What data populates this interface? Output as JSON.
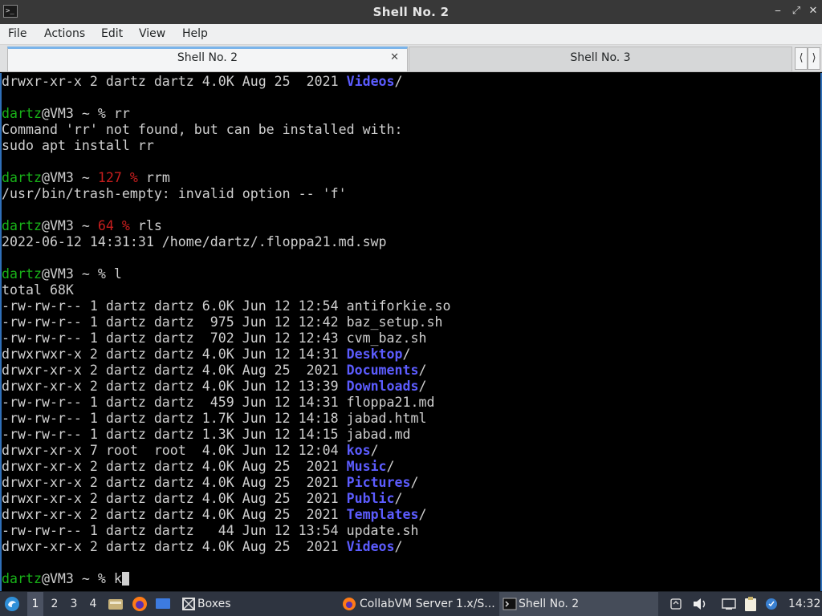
{
  "window": {
    "title": "Shell No. 2"
  },
  "menu": [
    "File",
    "Actions",
    "Edit",
    "View",
    "Help"
  ],
  "tabs": [
    {
      "label": "Shell No. 2",
      "active": true
    },
    {
      "label": "Shell No. 3",
      "active": false
    }
  ],
  "terminal": {
    "lines": [
      {
        "parts": [
          {
            "t": "drwxr-xr-x 2 dartz dartz 4.0K Aug 25  2021 "
          },
          {
            "t": "Videos",
            "c": "b"
          },
          {
            "t": "/"
          }
        ]
      },
      {
        "parts": []
      },
      {
        "parts": [
          {
            "t": "dartz",
            "c": "g"
          },
          {
            "t": "@VM3 ~ % rr"
          }
        ]
      },
      {
        "parts": [
          {
            "t": "Command 'rr' not found, but can be installed with:"
          }
        ]
      },
      {
        "parts": [
          {
            "t": "sudo apt install rr"
          }
        ]
      },
      {
        "parts": []
      },
      {
        "parts": [
          {
            "t": "dartz",
            "c": "g"
          },
          {
            "t": "@VM3 ~ "
          },
          {
            "t": "127 %",
            "c": "r"
          },
          {
            "t": " rrm"
          }
        ]
      },
      {
        "parts": [
          {
            "t": "/usr/bin/trash-empty: invalid option -- 'f'"
          }
        ]
      },
      {
        "parts": []
      },
      {
        "parts": [
          {
            "t": "dartz",
            "c": "g"
          },
          {
            "t": "@VM3 ~ "
          },
          {
            "t": "64 %",
            "c": "r"
          },
          {
            "t": " rls"
          }
        ]
      },
      {
        "parts": [
          {
            "t": "2022-06-12 14:31:31 /home/dartz/.floppa21.md.swp"
          }
        ]
      },
      {
        "parts": []
      },
      {
        "parts": [
          {
            "t": "dartz",
            "c": "g"
          },
          {
            "t": "@VM3 ~ % l"
          }
        ]
      },
      {
        "parts": [
          {
            "t": "total 68K"
          }
        ]
      },
      {
        "parts": [
          {
            "t": "-rw-rw-r-- 1 dartz dartz 6.0K Jun 12 12:54 antiforkie.so"
          }
        ]
      },
      {
        "parts": [
          {
            "t": "-rw-rw-r-- 1 dartz dartz  975 Jun 12 12:42 baz_setup.sh"
          }
        ]
      },
      {
        "parts": [
          {
            "t": "-rw-rw-r-- 1 dartz dartz  702 Jun 12 12:43 cvm_baz.sh"
          }
        ]
      },
      {
        "parts": [
          {
            "t": "drwxrwxr-x 2 dartz dartz 4.0K Jun 12 14:31 "
          },
          {
            "t": "Desktop",
            "c": "b"
          },
          {
            "t": "/"
          }
        ]
      },
      {
        "parts": [
          {
            "t": "drwxr-xr-x 2 dartz dartz 4.0K Aug 25  2021 "
          },
          {
            "t": "Documents",
            "c": "b"
          },
          {
            "t": "/"
          }
        ]
      },
      {
        "parts": [
          {
            "t": "drwxr-xr-x 2 dartz dartz 4.0K Jun 12 13:39 "
          },
          {
            "t": "Downloads",
            "c": "b"
          },
          {
            "t": "/"
          }
        ]
      },
      {
        "parts": [
          {
            "t": "-rw-rw-r-- 1 dartz dartz  459 Jun 12 14:31 floppa21.md"
          }
        ]
      },
      {
        "parts": [
          {
            "t": "-rw-rw-r-- 1 dartz dartz 1.7K Jun 12 14:18 jabad.html"
          }
        ]
      },
      {
        "parts": [
          {
            "t": "-rw-rw-r-- 1 dartz dartz 1.3K Jun 12 14:15 jabad.md"
          }
        ]
      },
      {
        "parts": [
          {
            "t": "drwxr-xr-x 7 root  root  4.0K Jun 12 12:04 "
          },
          {
            "t": "kos",
            "c": "b"
          },
          {
            "t": "/"
          }
        ]
      },
      {
        "parts": [
          {
            "t": "drwxr-xr-x 2 dartz dartz 4.0K Aug 25  2021 "
          },
          {
            "t": "Music",
            "c": "b"
          },
          {
            "t": "/"
          }
        ]
      },
      {
        "parts": [
          {
            "t": "drwxr-xr-x 2 dartz dartz 4.0K Aug 25  2021 "
          },
          {
            "t": "Pictures",
            "c": "b"
          },
          {
            "t": "/"
          }
        ]
      },
      {
        "parts": [
          {
            "t": "drwxr-xr-x 2 dartz dartz 4.0K Aug 25  2021 "
          },
          {
            "t": "Public",
            "c": "b"
          },
          {
            "t": "/"
          }
        ]
      },
      {
        "parts": [
          {
            "t": "drwxr-xr-x 2 dartz dartz 4.0K Aug 25  2021 "
          },
          {
            "t": "Templates",
            "c": "b"
          },
          {
            "t": "/"
          }
        ]
      },
      {
        "parts": [
          {
            "t": "-rw-rw-r-- 1 dartz dartz   44 Jun 12 13:54 update.sh"
          }
        ]
      },
      {
        "parts": [
          {
            "t": "drwxr-xr-x 2 dartz dartz 4.0K Aug 25  2021 "
          },
          {
            "t": "Videos",
            "c": "b"
          },
          {
            "t": "/"
          }
        ]
      },
      {
        "parts": []
      },
      {
        "parts": [
          {
            "t": "dartz",
            "c": "g"
          },
          {
            "t": "@VM3 ~ % k"
          }
        ],
        "cursor": true
      }
    ]
  },
  "panel": {
    "workspaces": [
      "1",
      "2",
      "3",
      "4"
    ],
    "current_workspace": "1",
    "tasks": [
      {
        "label": "Boxes",
        "icon": "boxes-icon"
      },
      {
        "label": "CollabVM Server 1.x/S...",
        "icon": "firefox-icon"
      },
      {
        "label": "Shell No. 2",
        "icon": "terminal-icon",
        "active": true
      }
    ],
    "clock": "14:32"
  },
  "colors": {
    "prompt_user": "#18b218",
    "exit_code": "#c81e1e",
    "directory": "#5c5cff",
    "focus_border": "#2f6fb8"
  }
}
